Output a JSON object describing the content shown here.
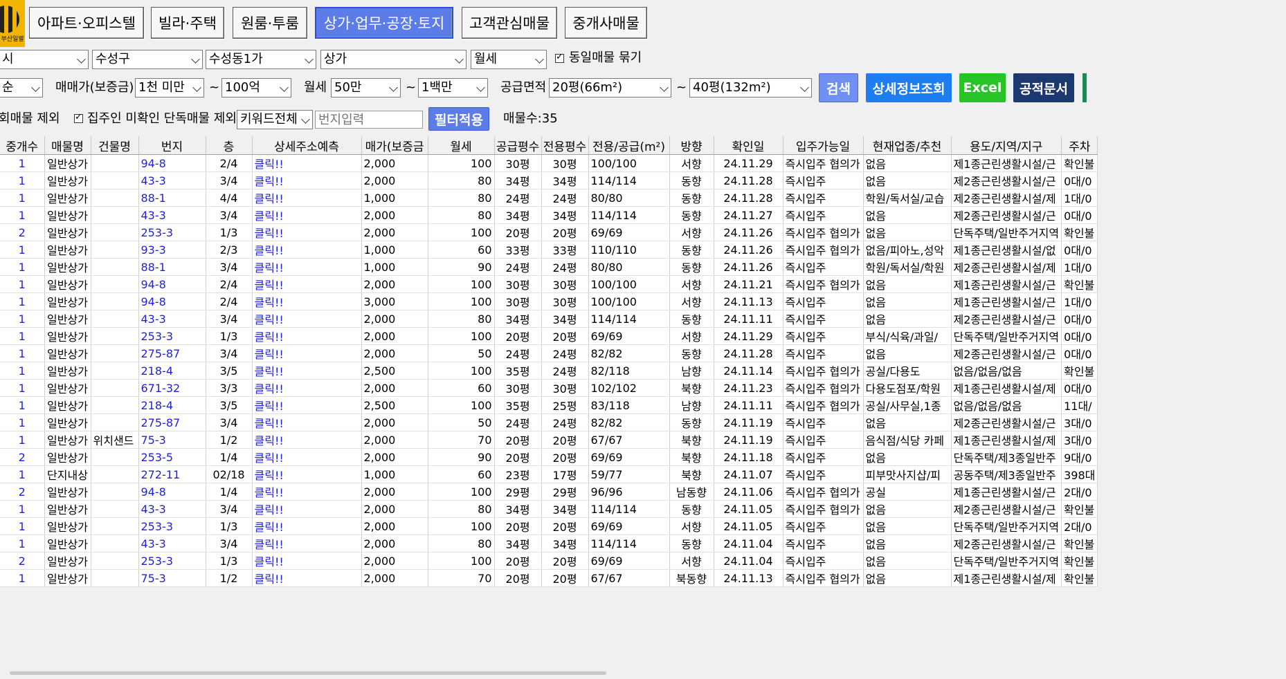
{
  "logo_text": "부산일벌",
  "tabs": [
    "아파트·오피스텔",
    "빌라·주택",
    "원룸·투룸",
    "상가·업무·공장·토지",
    "고객관심매물",
    "중개사매물"
  ],
  "filters1": {
    "city": "시",
    "district": "수성구",
    "dong": "수성동1가",
    "type": "상가",
    "deal": "월세",
    "group_label": "동일매물 묶기"
  },
  "filters2": {
    "sort": "순",
    "price_label": "매매가(보증금)",
    "price_min": "1천 미만",
    "tilde": "~",
    "price_max": "100억",
    "rent_label": "월세",
    "rent_min": "50만",
    "rent_max": "1백만",
    "area_label": "공급면적",
    "area_min": "20평(66m²)",
    "area_max": "40평(132m²)",
    "btn_search": "검색",
    "btn_detail": "상세정보조회",
    "btn_excel": "Excel",
    "btn_doc": "공적문서"
  },
  "filters3": {
    "exclude1": "회매물 제외",
    "exclude2": "집주인 미확인 단독매물 제외",
    "keyword": "키워드전체",
    "address_placeholder": "번지입력",
    "btn_filter": "필터적용",
    "count_label": "매물수:35"
  },
  "columns": [
    "중개수",
    "매물명",
    "건물명",
    "번지",
    "층",
    "상세주소예측",
    "매가(보증금",
    "월세",
    "공급평수",
    "전용평수",
    "전용/공급(m²)",
    "방향",
    "확인일",
    "입주가능일",
    "현재업종/추천",
    "용도/지역/지구",
    "주차"
  ],
  "rows": [
    [
      "1",
      "일반상가",
      "",
      "94-8",
      "2/4",
      "클릭!!",
      "2,000",
      "100",
      "30평",
      "30평",
      "100/100",
      "서향",
      "24.11.29",
      "즉시입주 협의가",
      "없음",
      "제1종근린생활시설/근",
      "확인불"
    ],
    [
      "1",
      "일반상가",
      "",
      "43-3",
      "3/4",
      "클릭!!",
      "2,000",
      "80",
      "34평",
      "34평",
      "114/114",
      "동향",
      "24.11.28",
      "즉시입주",
      "없음",
      "제2종근린생활시설/근",
      "0대/0"
    ],
    [
      "1",
      "일반상가",
      "",
      "88-1",
      "4/4",
      "클릭!!",
      "1,000",
      "80",
      "24평",
      "24평",
      "80/80",
      "동향",
      "24.11.28",
      "즉시입주",
      "학원/독서실/교습",
      "제2종근린생활시설/제",
      "1대/0"
    ],
    [
      "1",
      "일반상가",
      "",
      "43-3",
      "3/4",
      "클릭!!",
      "2,000",
      "80",
      "34평",
      "34평",
      "114/114",
      "동향",
      "24.11.27",
      "즉시입주",
      "없음",
      "제2종근린생활시설/근",
      "0대/0"
    ],
    [
      "2",
      "일반상가",
      "",
      "253-3",
      "1/3",
      "클릭!!",
      "2,000",
      "100",
      "20평",
      "20평",
      "69/69",
      "서향",
      "24.11.26",
      "즉시입주 협의가",
      "없음",
      "단독주택/일반주거지역",
      "확인불"
    ],
    [
      "1",
      "일반상가",
      "",
      "93-3",
      "2/3",
      "클릭!!",
      "1,000",
      "60",
      "33평",
      "33평",
      "110/110",
      "동향",
      "24.11.26",
      "즉시입주 협의가",
      "없음/피아노,성악",
      "제1종근린생활시설/없",
      "0대/0"
    ],
    [
      "1",
      "일반상가",
      "",
      "88-1",
      "3/4",
      "클릭!!",
      "1,000",
      "90",
      "24평",
      "24평",
      "80/80",
      "동향",
      "24.11.26",
      "즉시입주",
      "학원/독서실/학원",
      "제2종근린생활시설/제",
      "1대/0"
    ],
    [
      "1",
      "일반상가",
      "",
      "94-8",
      "2/4",
      "클릭!!",
      "2,000",
      "100",
      "30평",
      "30평",
      "100/100",
      "서향",
      "24.11.21",
      "즉시입주 협의가",
      "없음",
      "제1종근린생활시설/근",
      "확인불"
    ],
    [
      "1",
      "일반상가",
      "",
      "94-8",
      "2/4",
      "클릭!!",
      "3,000",
      "100",
      "30평",
      "30평",
      "100/100",
      "서향",
      "24.11.13",
      "즉시입주",
      "없음",
      "제1종근린생활시설/근",
      "1대/0"
    ],
    [
      "1",
      "일반상가",
      "",
      "43-3",
      "3/4",
      "클릭!!",
      "2,000",
      "80",
      "34평",
      "34평",
      "114/114",
      "동향",
      "24.11.11",
      "즉시입주",
      "없음",
      "제2종근린생활시설/근",
      "0대/0"
    ],
    [
      "1",
      "일반상가",
      "",
      "253-3",
      "1/3",
      "클릭!!",
      "2,000",
      "100",
      "20평",
      "20평",
      "69/69",
      "서향",
      "24.11.29",
      "즉시입주",
      "부식/식육/과일/",
      "단독주택/일반주거지역",
      "0대/0"
    ],
    [
      "1",
      "일반상가",
      "",
      "275-87",
      "3/4",
      "클릭!!",
      "2,000",
      "50",
      "24평",
      "24평",
      "82/82",
      "동향",
      "24.11.28",
      "즉시입주",
      "없음",
      "제2종근린생활시설/근",
      "0대/0"
    ],
    [
      "1",
      "일반상가",
      "",
      "218-4",
      "3/5",
      "클릭!!",
      "2,500",
      "100",
      "35평",
      "24평",
      "82/118",
      "남향",
      "24.11.14",
      "즉시입주 협의가",
      "공실/다용도",
      "없음/없음/없음",
      "확인불"
    ],
    [
      "1",
      "일반상가",
      "",
      "671-32",
      "3/3",
      "클릭!!",
      "2,000",
      "60",
      "30평",
      "30평",
      "102/102",
      "북향",
      "24.11.23",
      "즉시입주 협의가",
      "다용도점포/학원",
      "제1종근린생활시설/제",
      "0대/0"
    ],
    [
      "1",
      "일반상가",
      "",
      "218-4",
      "3/5",
      "클릭!!",
      "2,500",
      "100",
      "35평",
      "25평",
      "83/118",
      "남향",
      "24.11.11",
      "즉시입주 협의가",
      "공실/사무실,1종",
      "없음/없음/없음",
      "11대/"
    ],
    [
      "1",
      "일반상가",
      "",
      "275-87",
      "3/4",
      "클릭!!",
      "2,000",
      "50",
      "24평",
      "24평",
      "82/82",
      "동향",
      "24.11.19",
      "즉시입주",
      "없음",
      "제2종근린생활시설/근",
      "3대/0"
    ],
    [
      "1",
      "일반상가",
      "위치샌드",
      "75-3",
      "1/2",
      "클릭!!",
      "2,000",
      "70",
      "20평",
      "20평",
      "67/67",
      "북향",
      "24.11.19",
      "즉시입주",
      "음식점/식당 카페",
      "제1종근린생활시설/제",
      "3대/0"
    ],
    [
      "2",
      "일반상가",
      "",
      "253-5",
      "1/4",
      "클릭!!",
      "2,000",
      "90",
      "20평",
      "20평",
      "69/69",
      "북향",
      "24.11.18",
      "즉시입주",
      "없음",
      "단독주택/제3종일반주",
      "9대/0"
    ],
    [
      "1",
      "단지내상",
      "",
      "272-11",
      "02/18",
      "클릭!!",
      "1,000",
      "60",
      "23평",
      "17평",
      "59/77",
      "북향",
      "24.11.07",
      "즉시입주",
      "피부맛사지샵/피",
      "공동주택/제3종일반주",
      "398대"
    ],
    [
      "2",
      "일반상가",
      "",
      "94-8",
      "1/4",
      "클릭!!",
      "2,000",
      "100",
      "29평",
      "29평",
      "96/96",
      "남동향",
      "24.11.06",
      "즉시입주 협의가",
      "공실",
      "제1종근린생활시설/근",
      "2대/0"
    ],
    [
      "1",
      "일반상가",
      "",
      "43-3",
      "3/4",
      "클릭!!",
      "2,000",
      "80",
      "34평",
      "34평",
      "114/114",
      "동향",
      "24.11.05",
      "즉시입주 협의가",
      "없음",
      "제2종근린생활시설/근",
      "확인불"
    ],
    [
      "1",
      "일반상가",
      "",
      "253-3",
      "1/3",
      "클릭!!",
      "2,000",
      "100",
      "20평",
      "20평",
      "69/69",
      "서향",
      "24.11.05",
      "즉시입주",
      "없음",
      "단독주택/일반주거지역",
      "2대/0"
    ],
    [
      "1",
      "일반상가",
      "",
      "43-3",
      "3/4",
      "클릭!!",
      "2,000",
      "80",
      "34평",
      "34평",
      "114/114",
      "동향",
      "24.11.04",
      "즉시입주",
      "없음",
      "제2종근린생활시설/근",
      "확인불"
    ],
    [
      "2",
      "일반상가",
      "",
      "253-3",
      "1/3",
      "클릭!!",
      "2,000",
      "100",
      "20평",
      "20평",
      "69/69",
      "서향",
      "24.11.04",
      "즉시입주",
      "없음",
      "단독주택/일반주거지역",
      "확인불"
    ],
    [
      "1",
      "일반상가",
      "",
      "75-3",
      "1/2",
      "클릭!!",
      "2,000",
      "70",
      "20평",
      "20평",
      "67/67",
      "북동향",
      "24.11.13",
      "즉시입주 협의가",
      "없음",
      "제1종근린생활시설/제",
      "확인불"
    ]
  ]
}
